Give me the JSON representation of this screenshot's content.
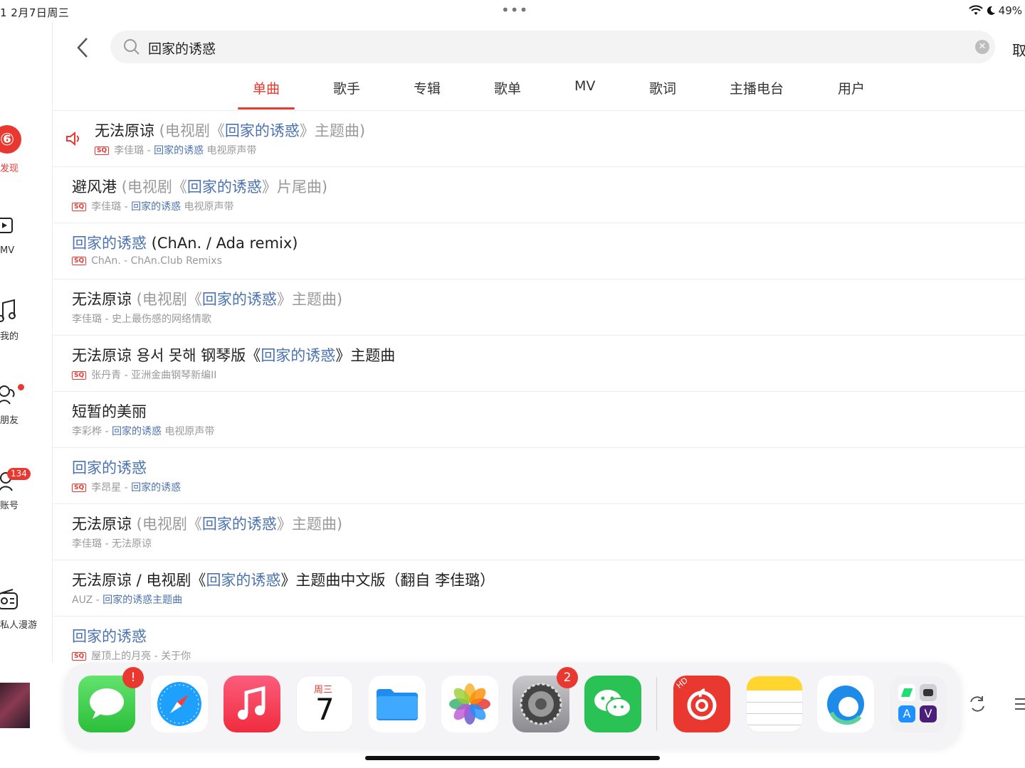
{
  "status": {
    "time": "1   2月7日周三",
    "battery": "49%"
  },
  "sidebar": {
    "items": [
      {
        "label": "发现",
        "icon": "netease-logo-icon"
      },
      {
        "label": "MV",
        "icon": "mv-icon"
      },
      {
        "label": "我的",
        "icon": "music-note-icon"
      },
      {
        "label": "朋友",
        "icon": "friends-icon"
      },
      {
        "label": "账号",
        "icon": "account-icon",
        "badge": "134"
      },
      {
        "label": "私人漫游",
        "icon": "radio-icon"
      }
    ]
  },
  "search": {
    "query": "回家的诱惑",
    "cancel": "取"
  },
  "tabs": [
    {
      "label": "单曲",
      "active": true
    },
    {
      "label": "歌手"
    },
    {
      "label": "专辑"
    },
    {
      "label": "歌单"
    },
    {
      "label": "MV"
    },
    {
      "label": "歌词"
    },
    {
      "label": "主播电台"
    },
    {
      "label": "用户"
    }
  ],
  "sq_label": "SQ",
  "songs": [
    {
      "t1": "无法原谅",
      "t2": " (电视剧《",
      "t3": "回家的诱惑",
      "t4": "》主题曲)",
      "s1": "李佳璐 - ",
      "s2": "回家的诱惑",
      "s3": " 电视原声带"
    },
    {
      "t1": "避风港",
      "t2": " (电视剧《",
      "t3": "回家的诱惑",
      "t4": "》片尾曲)",
      "s1": "李佳璐 - ",
      "s2": "回家的诱惑",
      "s3": " 电视原声带"
    },
    {
      "t1": "回家的诱惑",
      "t2": "  (ChAn. / Ada remix)",
      "s1": "ChAn. - ChAn.Club Remixs"
    },
    {
      "t1": "无法原谅",
      "t2": " (电视剧《",
      "t3": "回家的诱惑",
      "t4": "》主题曲)",
      "s1": "李佳璐 - 史上最伤感的网络情歌"
    },
    {
      "t1": "无法原谅 용서 못해 钢琴版《",
      "t2": "回家的诱惑",
      "t3": "》主题曲",
      "s1": "张丹青 - 亚洲金曲钢琴新编II"
    },
    {
      "t1": "短暂的美丽",
      "s1": "李彩桦 - ",
      "s2": "回家的诱惑",
      "s3": " 电视原声带"
    },
    {
      "t1": "回家的诱惑",
      "s1": "李昂星 - ",
      "s2": "回家的诱惑"
    },
    {
      "t1": "无法原谅",
      "t2": " (电视剧《",
      "t3": "回家的诱惑",
      "t4": "》主题曲)",
      "s1": "李佳璐 - 无法原谅"
    },
    {
      "t1": "无法原谅 / 电视剧《",
      "t2": "回家的诱惑",
      "t3": "》主题曲中文版（翻自 李佳璐）",
      "s1": "AUZ - ",
      "s2": "回家的诱惑主题曲"
    },
    {
      "t1": "回家的诱惑",
      "s1": "屋顶上的月亮 - 关于你"
    }
  ],
  "dock": {
    "apps": [
      {
        "name": "Messages",
        "badge": "!"
      },
      {
        "name": "Safari"
      },
      {
        "name": "Music"
      },
      {
        "name": "Calendar",
        "day_label": "周三",
        "day": "7"
      },
      {
        "name": "Files"
      },
      {
        "name": "Photos"
      },
      {
        "name": "Settings",
        "badge": "2"
      },
      {
        "name": "WeChat"
      },
      {
        "name": "NetEase Cloud Music HD",
        "tag": "HD"
      },
      {
        "name": "Notes"
      },
      {
        "name": "Edge"
      },
      {
        "name": "App Library"
      }
    ]
  },
  "colors": {
    "accent": "#e8382f",
    "highlight": "#4a72b0"
  }
}
